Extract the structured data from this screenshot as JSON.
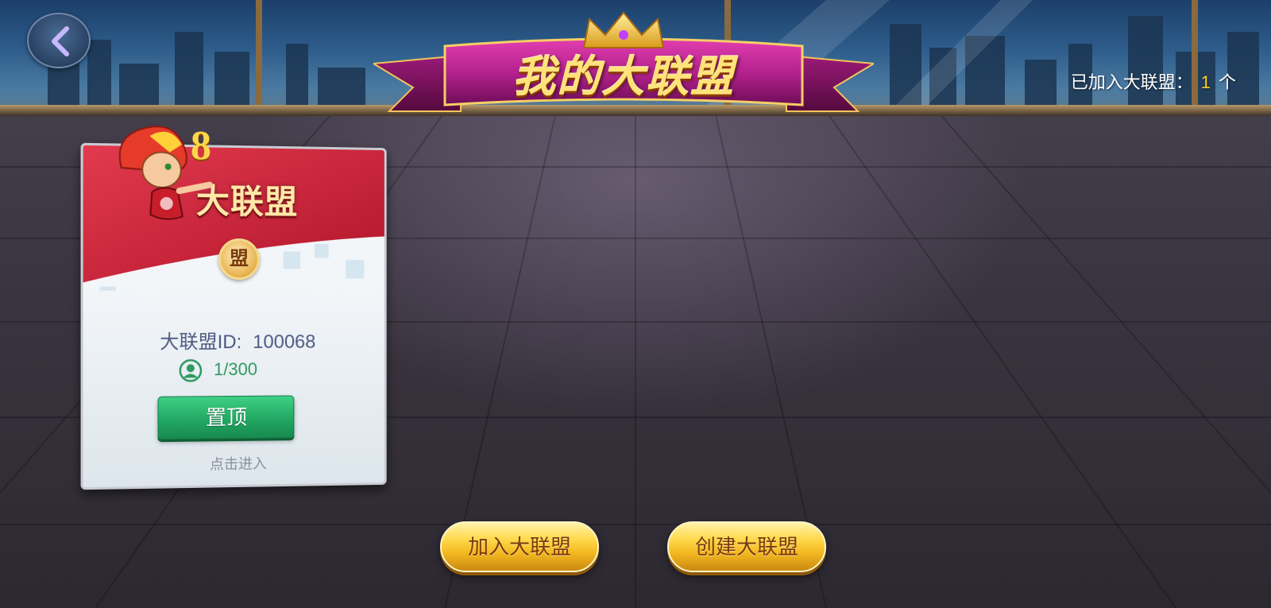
{
  "header": {
    "title": "我的大联盟",
    "back_icon": "chevron-left-icon"
  },
  "joined_count": {
    "label": "已加入大联盟：",
    "value": "1",
    "unit": "个"
  },
  "alliance_card": {
    "heading": "大联盟",
    "badge_number": "8",
    "medal_text": "盟",
    "id_label": "大联盟ID:",
    "id_value": "100068",
    "members_icon": "user-icon",
    "members": "1/300",
    "pin_button": "置顶",
    "enter_hint": "点击进入"
  },
  "actions": {
    "join": "加入大联盟",
    "create": "创建大联盟"
  },
  "colors": {
    "gold_text": "#ffd21a",
    "pin_green": "#22a863",
    "members_green": "#2f9a60",
    "banner_magenta": "#b0208a"
  }
}
